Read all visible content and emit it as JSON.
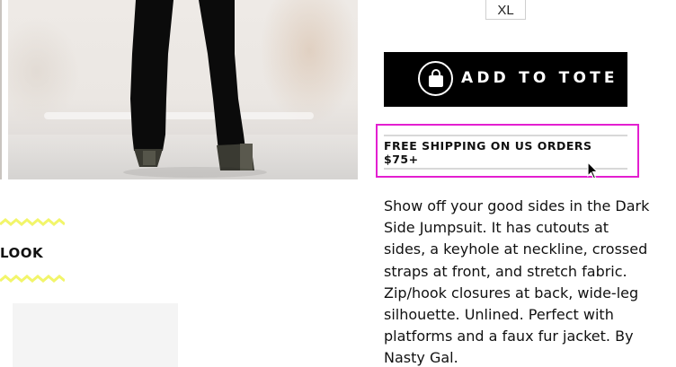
{
  "product": {
    "image_alt": "Dark Side Jumpsuit worn with glitter platforms",
    "size_option": "XL",
    "add_to_tote_label": "ADD TO TOTE",
    "shipping_banner": "FREE SHIPPING ON US ORDERS $75+",
    "description": "Show off your good sides in the Dark Side Jumpsuit. It has cutouts at sides, a keyhole at neckline, crossed straps at front, and stretch fabric. Zip/hook closures at back, wide-leg silhouette. Unlined. Perfect with platforms and a faux fur jacket. By Nasty Gal."
  },
  "section": {
    "look_heading": "LOOK"
  },
  "colors": {
    "accent_yellow": "#f2f56a",
    "highlight_magenta": "#e31fd0",
    "button_bg": "#000000"
  },
  "icons": {
    "tote": "shopping-bag-icon",
    "cursor": "mouse-pointer-icon"
  }
}
